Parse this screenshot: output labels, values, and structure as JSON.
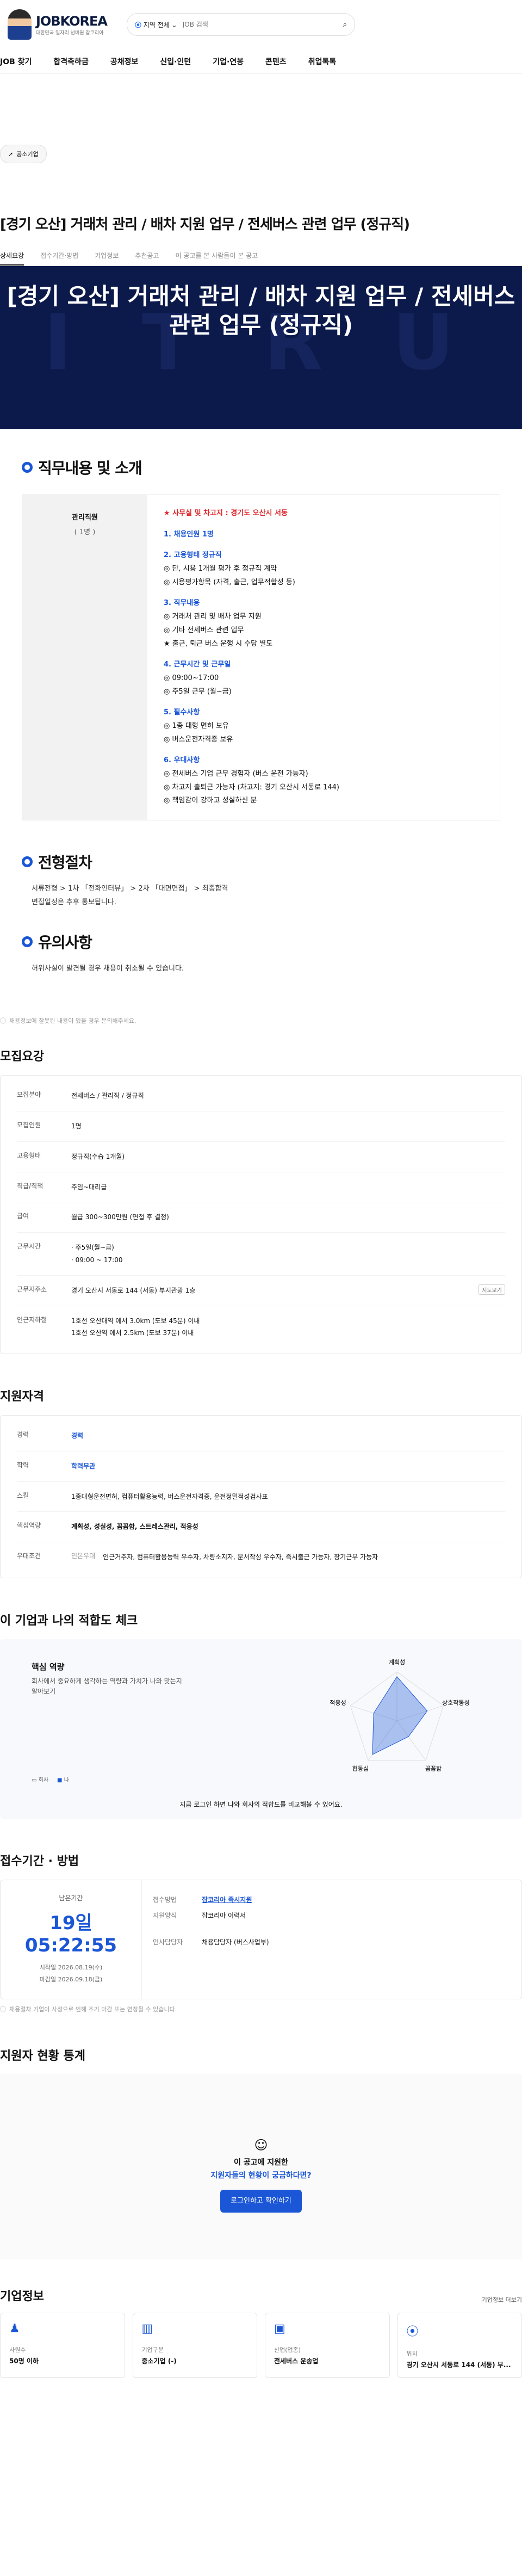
{
  "header": {
    "logo": "JOBKOREA",
    "logo_sub": "대한민국 일자리 넘버원 잡코리아",
    "location_label": "지역 전체",
    "search_placeholder": "JOB 검색"
  },
  "gnb": [
    "JOB 찾기",
    "합격축하금",
    "공채정보",
    "신입·인턴",
    "기업·연봉",
    "콘텐츠",
    "취업톡톡"
  ],
  "tag": "공소기업",
  "job_title": "[경기 오산] 거래처 관리 / 배차 지원 업무 / 전세버스 관련 업무 (정규직)",
  "tabs": [
    "상세요강",
    "접수기간·방법",
    "기업정보",
    "추천공고",
    "이 공고를 본 사람들이 본 공고"
  ],
  "banner": {
    "title": "[경기 오산] 거래처 관리 / 배차 지원 업무 / 전세버스 관련 업무 (정규직)",
    "bg": "I T R U"
  },
  "detail": {
    "heading": "직무내용 및 소개",
    "left_label": "관리직원",
    "left_count": "( 1명 )",
    "lines": [
      "★ 사무실 및 차고지 : 경기도 오산시 서동",
      "",
      "1. 채용인원 1명",
      "",
      "2. 고용형태 정규직",
      "◎ 단, 시용 1개월 평가 후 정규직 계약",
      "◎ 시용평가항목 (자격, 출근, 업무적합성 등)",
      "",
      "3. 직무내용",
      "◎ 거래처 관리 및 배차 업무 지원",
      "◎ 기타 전세버스 관련 업무",
      "★ 출근, 퇴근 버스 운행 시 수당 별도",
      "",
      "4. 근무시간 및 근무일",
      "◎ 09:00~17:00",
      "◎ 주5일 근무 (월~금)",
      "",
      "5. 필수사항",
      "◎ 1종 대형 면허 보유",
      "◎ 버스운전자격증 보유",
      "",
      "6. 우대사항",
      "◎ 전세버스 기업 근무 경험자 (버스 운전 가능자)",
      "◎ 차고지 출퇴근 가능자 (차고지: 경기 오산시 서동로 144)",
      "◎ 책임감이 강하고 성실하신 분"
    ]
  },
  "process": {
    "heading": "전형절차",
    "text": "서류전형 > 1차 「전화인터뷰」 > 2차 「대면면접」 > 최종합격",
    "text2": "면접일정은 추후 통보됩니다."
  },
  "notice": {
    "heading": "유의사항",
    "text": "허위사실이 발견될 경우 채용이 취소될 수 있습니다."
  },
  "footnote": "채용정보에 잘못된 내용이 있을 경우 문의해주세요.",
  "recruit": {
    "heading": "모집요강",
    "rows": [
      {
        "k": "모집분야",
        "v": "전세버스 / 관리직 / 정규직"
      },
      {
        "k": "모집인원",
        "v": "1명"
      },
      {
        "k": "고용형태",
        "v": "정규직(수습 1개월)"
      },
      {
        "k": "직급/직책",
        "v": "주임~대리급"
      },
      {
        "k": "급여",
        "v": "월급 300~300만원 (면접 후 결정)"
      },
      {
        "k": "근무시간",
        "v": "· 주5일(월~금)\n· 09:00 ~ 17:00"
      },
      {
        "k": "근무지주소",
        "v": "경기 오산시 서동로 144 (서동) 부지관광 1층",
        "btn": "지도보기"
      },
      {
        "k": "인근지하철",
        "v": "1호선 오산대역 에서 3.0km (도보 45분) 이내\n1호선 오산역 에서 2.5km (도보 37분) 이내"
      }
    ]
  },
  "qual": {
    "heading": "지원자격",
    "rows": [
      {
        "k": "경력",
        "v": "경력"
      },
      {
        "k": "학력",
        "v": "학력무관"
      },
      {
        "k": "스킬",
        "v": "1종대형운전면허, 컴퓨터활용능력, 버스운전자격증, 운전정밀적성검사표"
      },
      {
        "k": "핵심역량",
        "v": "계획성, 성실성, 꼼꼼함, 스트레스관리, 적응성"
      },
      {
        "k": "우대조건",
        "v": "인근거주자, 컴퓨터활용능력 우수자, 차량소지자, 문서작성 우수자, 즉시출근 가능자, 장기근무 가능자",
        "pre": "인본우대"
      }
    ]
  },
  "fit": {
    "heading": "이 기업과 나의 적합도 체크",
    "title": "핵심 역량",
    "desc": "회사에서 중요하게 생각하는 역량과 가치가 나와 맞는지 알아보기",
    "legend_company": "회사",
    "legend_me": "나",
    "axes": [
      "계획성",
      "상호작동성",
      "꼼꼼함",
      "협동심",
      "적응성"
    ],
    "cap": "지금 로그인 하면 나와 회사의 적합도를 비교해볼 수 있어요."
  },
  "receipt": {
    "heading": "접수기간 · 방법",
    "left_label": "남은기간",
    "time": "19일 05:22:55",
    "start_label": "시작일",
    "start": "2026.08.19(수)",
    "end_label": "마감일",
    "end": "2026.09.18(금)",
    "method_label": "접수방법",
    "method": "잡코리아 즉시지원",
    "form_label": "지원양식",
    "form": "잡코리아 이력서",
    "manager_label": "인사담당자",
    "manager": "채용담당자 (버스사업부)",
    "note": "채용절차 기업이 사정으로 인해 조기 마감 또는 연장될 수 있습니다."
  },
  "stats": {
    "heading": "지원자 현황 통계",
    "q1": "이 공고에 지원한",
    "q2": "지원자들의 현황이 궁금하다면?",
    "btn": "로그인하고 확인하기"
  },
  "company": {
    "heading": "기업정보",
    "link": "기업정보 더보기",
    "cards": [
      {
        "lb": "사원수",
        "vl": "50명 이하"
      },
      {
        "lb": "기업구분",
        "vl": "중소기업 (-)"
      },
      {
        "lb": "산업(업종)",
        "vl": "전세버스 운송업"
      },
      {
        "lb": "위치",
        "vl": "경기 오산시 서동로 144 (서동) 부..."
      }
    ]
  }
}
